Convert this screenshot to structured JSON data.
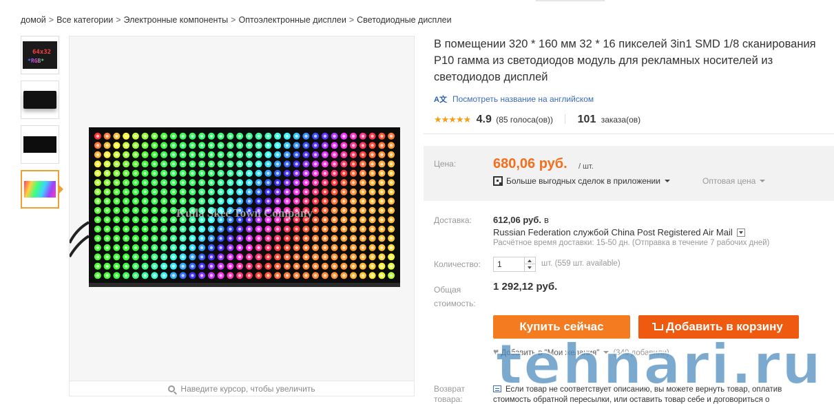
{
  "breadcrumb": {
    "items": [
      "домой",
      "Все категории",
      "Электронные компоненты",
      "Оптоэлектронные дисплеи",
      "Светодиодные дисплеи"
    ],
    "separator": ">"
  },
  "gallery": {
    "thumbnail_1_text": "64x32",
    "thumbnail_1_text2": "*RGB*",
    "zoom_hint": "Наведите курсор, чтобы увеличить",
    "image_watermark": "Kuila Skee Town Company"
  },
  "product": {
    "title": "В помещении 320 * 160 мм 32 * 16 пикселей 3in1 SMD 1/8 сканирования P10 гамма из светодиодов модуль для рекламных носителей из светодиодов дисплей",
    "translate_icon": "A文",
    "translate_link": "Посмотреть название на английском",
    "stars": "★★★★★",
    "rating": "4.9",
    "rating_count": "(85 голоса(ов))",
    "orders_count": "101",
    "orders_label": "заказа(ов)"
  },
  "price": {
    "label": "Цена:",
    "value": "680,06 руб.",
    "unit": "/ шт.",
    "app_deals": "Больше выгодных сделок в приложении",
    "wholesale": "Оптовая цена"
  },
  "shipping": {
    "label": "Доставка:",
    "price": "612,06 руб.",
    "price_suffix": "в",
    "method": "Russian Federation службой China Post Registered Air Mail",
    "estimate": "Расчётное время доставки: 15-50 дн. (Отправка в течение 7 рабочих дней)"
  },
  "quantity": {
    "label": "Количество:",
    "value": "1",
    "available": "шт. (559 шт. available)"
  },
  "total": {
    "label_line1": "Общая",
    "label_line2": "стоимость:",
    "value": "1 292,12 руб."
  },
  "actions": {
    "buy_now": "Купить сейчас",
    "add_to_cart": "Добавить в корзину",
    "wishlist": "Добавить в \"Мои желания\"",
    "wishlist_count": "(340 добавили)"
  },
  "returns": {
    "label_line1": "Возврат",
    "label_line2": "товара:",
    "text": "Если товар не соответствует описанию, вы можете вернуть товар, оплатив стоимость обратной пересылки, или оставить товар себе и договориться о"
  },
  "watermark": "tehnari.ru",
  "colors": {
    "price": "#f56e1c",
    "buy_button": "#f57b21",
    "cart_button": "#ee5b10",
    "link": "#3a6bbf",
    "stars": "#f59d16"
  }
}
